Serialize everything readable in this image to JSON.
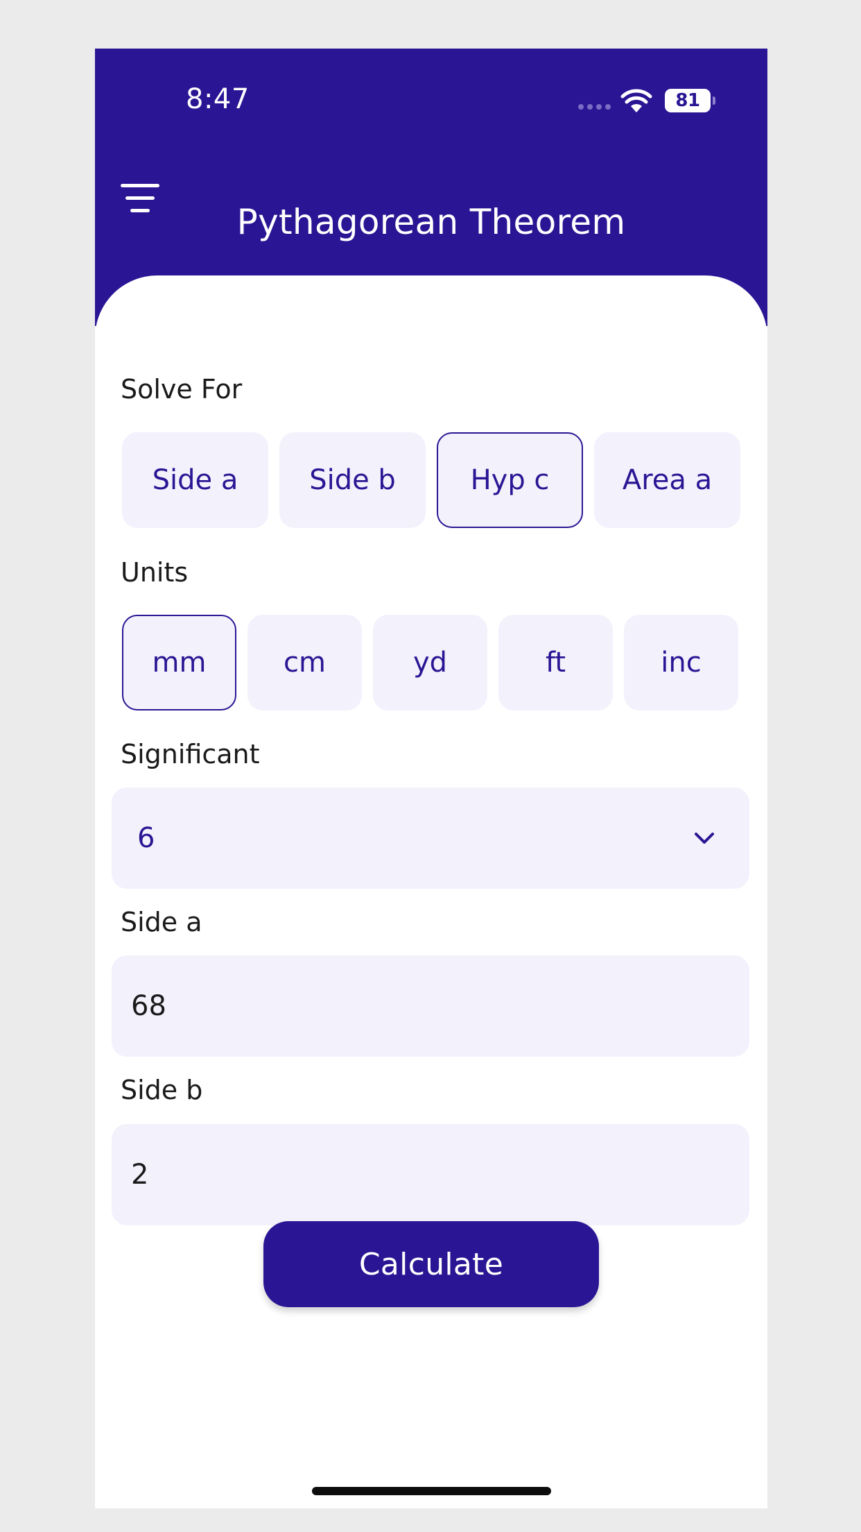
{
  "status_bar": {
    "time": "8:47",
    "battery": "81"
  },
  "header": {
    "title": "Pythagorean Theorem"
  },
  "solve_for": {
    "label": "Solve For",
    "options": [
      "Side a",
      "Side b",
      "Hyp c",
      "Area a"
    ],
    "selected": "Hyp c"
  },
  "units": {
    "label": "Units",
    "options": [
      "mm",
      "cm",
      "yd",
      "ft",
      "inc"
    ],
    "selected": "mm"
  },
  "significant": {
    "label": "Significant",
    "value": "6"
  },
  "side_a": {
    "label": "Side a",
    "value": "68"
  },
  "side_b": {
    "label": "Side b",
    "value": "2"
  },
  "calculate_label": "Calculate",
  "colors": {
    "primary": "#2a1694",
    "field_bg": "#f3f1fc",
    "page_bg": "#ebebeb"
  }
}
